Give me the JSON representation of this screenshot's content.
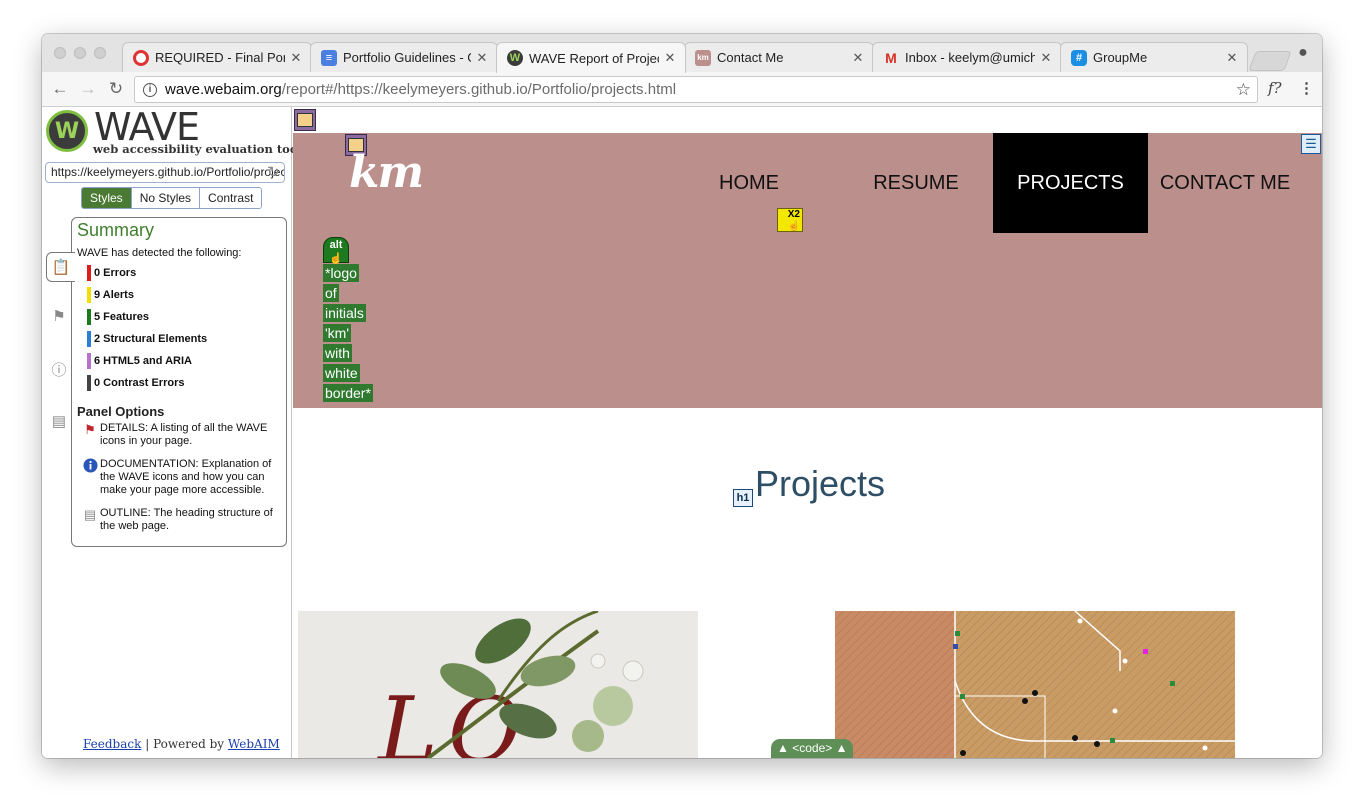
{
  "browser": {
    "tabs": [
      {
        "label": "REQUIRED - Final Portf",
        "icon": "lifebuoy-icon"
      },
      {
        "label": "Portfolio Guidelines - G",
        "icon": "google-docs-icon"
      },
      {
        "label": "WAVE Report of Projec",
        "icon": "wave-icon"
      },
      {
        "label": "Contact Me",
        "icon": "km-favicon"
      },
      {
        "label": "Inbox - keelym@umich.",
        "icon": "gmail-icon"
      },
      {
        "label": "GroupMe",
        "icon": "groupme-icon"
      }
    ],
    "address": {
      "host": "wave.webaim.org",
      "path": "/report#/https://keelymeyers.github.io/Portfolio/projects.html"
    },
    "extension_label": "f?"
  },
  "wave": {
    "logo_text": "WAVE",
    "logo_subtitle": "web accessibility evaluation tool",
    "url_value": "https://keelymeyers.github.io/Portfolio/projects.html",
    "view_toggles": [
      "Styles",
      "No Styles",
      "Contrast"
    ],
    "summary": {
      "title": "Summary",
      "intro": "WAVE has detected the following:",
      "items": [
        {
          "label": "0 Errors",
          "color": "#e01b1b"
        },
        {
          "label": "9 Alerts",
          "color": "#f0e000"
        },
        {
          "label": "5 Features",
          "color": "#1b7a1b"
        },
        {
          "label": "2 Structural Elements",
          "color": "#2a7fd4"
        },
        {
          "label": "6 HTML5 and ARIA",
          "color": "#b574c9"
        },
        {
          "label": "0 Contrast Errors",
          "color": "#444444"
        }
      ]
    },
    "panel_options": {
      "title": "Panel Options",
      "items": [
        {
          "text": "DETAILS: A listing of all the WAVE icons in your page.",
          "icon": "flag-icon"
        },
        {
          "text": "DOCUMENTATION: Explanation of the WAVE icons and how you can make your page more accessible.",
          "icon": "info-icon"
        },
        {
          "text": "OUTLINE: The heading structure of the web page.",
          "icon": "document-icon"
        }
      ]
    },
    "footer": {
      "feedback": "Feedback",
      "separator": "|",
      "powered_by": "Powered by",
      "webaim": "WebAIM"
    }
  },
  "site": {
    "logo": "km",
    "nav": [
      "HOME",
      "RESUME",
      "PROJECTS",
      "CONTACT ME"
    ],
    "active_nav": "PROJECTS",
    "alt_icon_label": "alt",
    "x2_label": "X2",
    "h1_icon_label": "h1",
    "alt_text_words": [
      "*logo",
      "of",
      "initials",
      "'km'",
      "with",
      "white",
      "border*"
    ],
    "heading": "Projects",
    "code_toggle": "▲ <code> ▲",
    "colors": {
      "banner": "#bb8f8c",
      "nav_active": "#000000",
      "heading": "#2e4e66"
    }
  }
}
